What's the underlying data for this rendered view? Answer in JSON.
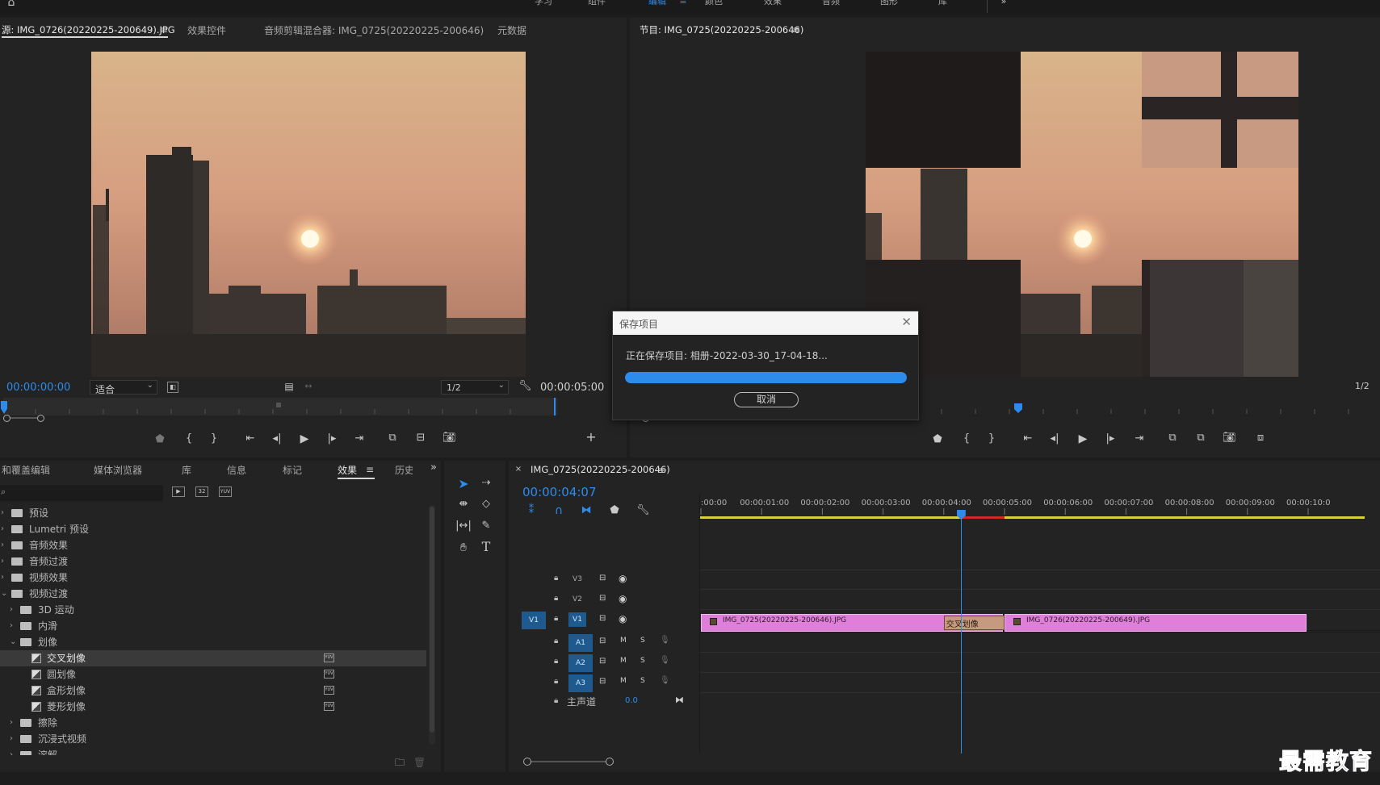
{
  "topbar": {
    "tabs": [
      "学习",
      "组件",
      "编辑",
      "颜色",
      "效果",
      "音频",
      "图形",
      "库"
    ],
    "active_tab": "编辑"
  },
  "source_panel": {
    "tabs": [
      "源: IMG_0726(20220225-200649).JPG",
      "效果控件",
      "音频剪辑混合器: IMG_0725(20220225-200646)",
      "元数据"
    ],
    "timecode_in": "00:00:00:00",
    "fit_label": "适合",
    "resolution": "1/2",
    "timecode_out": "00:00:05:00"
  },
  "program_panel": {
    "title": "节目: IMG_0725(20220225-200646)",
    "resolution": "1/2"
  },
  "dialog": {
    "title": "保存项目",
    "message": "正在保存项目: 相册-2022-03-30_17-04-18...",
    "progress": 1.0,
    "cancel_label": "取消"
  },
  "effects_panel": {
    "tabs": [
      "和覆盖编辑",
      "媒体浏览器",
      "库",
      "信息",
      "标记",
      "效果",
      "历史"
    ],
    "active_tab": "效果",
    "tree": [
      {
        "label": "预设",
        "level": 0,
        "type": "folder-star",
        "expanded": false
      },
      {
        "label": "Lumetri 预设",
        "level": 0,
        "type": "folder-star",
        "expanded": false
      },
      {
        "label": "音频效果",
        "level": 0,
        "type": "folder",
        "expanded": false
      },
      {
        "label": "音频过渡",
        "level": 0,
        "type": "folder",
        "expanded": false
      },
      {
        "label": "视频效果",
        "level": 0,
        "type": "folder",
        "expanded": false
      },
      {
        "label": "视频过渡",
        "level": 0,
        "type": "folder",
        "expanded": true
      },
      {
        "label": "3D 运动",
        "level": 1,
        "type": "folder",
        "expanded": false
      },
      {
        "label": "内滑",
        "level": 1,
        "type": "folder",
        "expanded": false
      },
      {
        "label": "划像",
        "level": 1,
        "type": "folder",
        "expanded": true
      },
      {
        "label": "交叉划像",
        "level": 2,
        "type": "effect",
        "selected": true
      },
      {
        "label": "圆划像",
        "level": 2,
        "type": "effect"
      },
      {
        "label": "盒形划像",
        "level": 2,
        "type": "effect"
      },
      {
        "label": "菱形划像",
        "level": 2,
        "type": "effect"
      },
      {
        "label": "擦除",
        "level": 1,
        "type": "folder",
        "expanded": false
      },
      {
        "label": "沉浸式视频",
        "level": 1,
        "type": "folder",
        "expanded": false
      },
      {
        "label": "溶解",
        "level": 1,
        "type": "folder",
        "expanded": false
      }
    ]
  },
  "timeline": {
    "sequence_name": "IMG_0725(20220225-200646)",
    "timecode": "00:00:04:07",
    "ruler": [
      ":00:00",
      "00:00:01:00",
      "00:00:02:00",
      "00:00:03:00",
      "00:00:04:00",
      "00:00:05:00",
      "00:00:06:00",
      "00:00:07:00",
      "00:00:08:00",
      "00:00:09:00",
      "00:00:10:0"
    ],
    "tracks": {
      "video": [
        "V3",
        "V2",
        "V1"
      ],
      "audio": [
        "A1",
        "A2",
        "A3"
      ],
      "source_patch": "V1",
      "mute": "M",
      "solo": "S",
      "master_label": "主声道",
      "master_value": "0.0"
    },
    "clips": [
      {
        "name": "IMG_0725(20220225-200646).JPG",
        "start": 0,
        "end": 5
      },
      {
        "name": "IMG_0726(20220225-200649).JPG",
        "start": 5,
        "end": 10
      }
    ],
    "transition": {
      "name": "交叉划像",
      "start": 4,
      "end": 5
    },
    "playhead_seconds": 4.28
  },
  "watermark": "最需教育",
  "colors": {
    "accent": "#2d8ceb",
    "clip": "#e07fd9",
    "transition": "#c69a7e",
    "work_area": "#d8d03c",
    "render_red": "#d02828"
  }
}
